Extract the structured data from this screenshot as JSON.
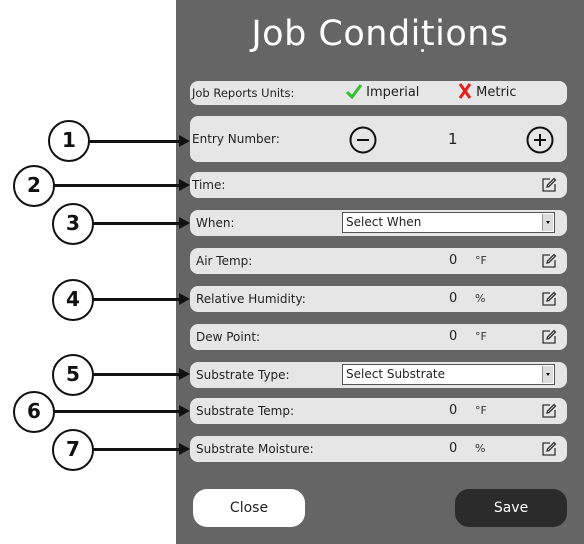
{
  "title": "Job Conditions",
  "units": {
    "label": "Job Reports Units:",
    "imperial": "Imperial",
    "metric": "Metric"
  },
  "entry": {
    "label": "Entry Number:",
    "value": "1"
  },
  "time": {
    "label": "Time:"
  },
  "when": {
    "label": "When:",
    "select": "Select When"
  },
  "air_temp": {
    "label": "Air Temp:",
    "value": "0",
    "unit": "°F"
  },
  "humidity": {
    "label": "Relative Humidity:",
    "value": "0",
    "unit": "%"
  },
  "dew_point": {
    "label": "Dew Point:",
    "value": "0",
    "unit": "°F"
  },
  "substrate_type": {
    "label": "Substrate Type:",
    "select": "Select Substrate"
  },
  "substrate_temp": {
    "label": "Substrate Temp:",
    "value": "0",
    "unit": "°F"
  },
  "substrate_moisture": {
    "label": "Substrate Moisture:",
    "value": "0",
    "unit": "%"
  },
  "buttons": {
    "close": "Close",
    "save": "Save"
  },
  "callouts": [
    "1",
    "2",
    "3",
    "4",
    "5",
    "6",
    "7"
  ],
  "colors": {
    "panel": "#656565",
    "row": "#e6e6e6",
    "check": "#2fc02f",
    "cross": "#e02020",
    "save_bg": "#2b2b2b"
  }
}
